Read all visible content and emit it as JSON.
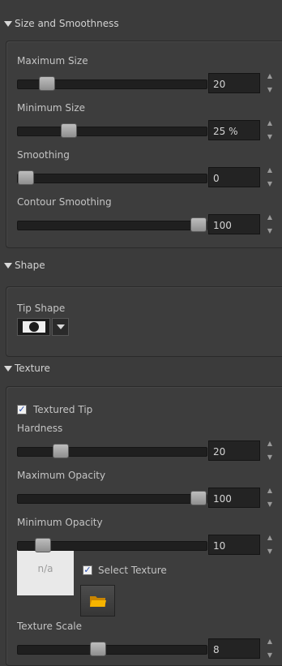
{
  "sections": {
    "size": {
      "title": "Size and Smoothness"
    },
    "shape": {
      "title": "Shape",
      "tip_label": "Tip Shape"
    },
    "texture": {
      "title": "Texture",
      "textured_tip_label": "Textured Tip",
      "textured_tip_checked": true,
      "select_texture_label": "Select Texture",
      "select_texture_checked": true,
      "preview_text": "n/a"
    }
  },
  "sliders": {
    "max_size": {
      "label": "Maximum Size",
      "value": "20",
      "level": 0.12
    },
    "min_size": {
      "label": "Minimum Size",
      "value": "25 %",
      "level": 0.25
    },
    "smoothing": {
      "label": "Smoothing",
      "value": "0",
      "level": 0.0
    },
    "contour": {
      "label": "Contour Smoothing",
      "value": "100",
      "level": 1.0
    },
    "hardness": {
      "label": "Hardness",
      "value": "20",
      "level": 0.2
    },
    "max_opacity": {
      "label": "Maximum Opacity",
      "value": "100",
      "level": 1.0
    },
    "min_opacity": {
      "label": "Minimum Opacity",
      "value": "10",
      "level": 0.1
    },
    "texture_scale": {
      "label": "Texture Scale",
      "value": "8",
      "level": 0.42
    }
  },
  "icons": {
    "section_toggle": "triangle-down-icon",
    "spin": "spin-arrows-icon",
    "dropdown": "chevron-down-icon",
    "folder": "folder-icon"
  },
  "colors": {
    "background": "#3b3b3b",
    "field": "#232323",
    "folder": "#f2a500"
  }
}
